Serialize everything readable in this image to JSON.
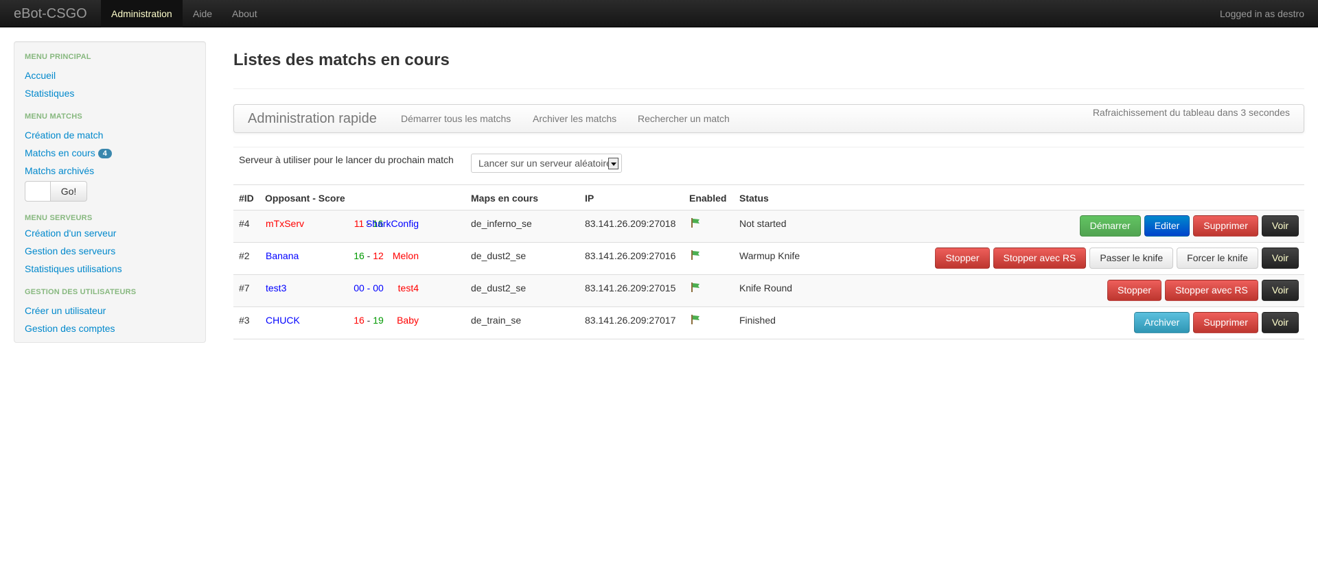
{
  "navbar": {
    "brand": "eBot-CSGO",
    "items": [
      {
        "label": "Administration",
        "active": true
      },
      {
        "label": "Aide",
        "active": false
      },
      {
        "label": "About",
        "active": false
      }
    ],
    "logged_in": "Logged in as destro"
  },
  "sidebar": {
    "headers": [
      "MENU PRINCIPAL",
      "MENU MATCHS",
      "MENU SERVEURS",
      "GESTION DES UTILISATEURS"
    ],
    "main": [
      "Accueil",
      "Statistiques"
    ],
    "matchs": [
      "Création de match",
      "Matchs en cours",
      "Matchs archivés"
    ],
    "matchs_badge": "4",
    "go_label": "Go!",
    "servers": [
      "Création d'un serveur",
      "Gestion des serveurs",
      "Statistiques utilisations"
    ],
    "users": [
      "Créer un utilisateur",
      "Gestion des comptes"
    ]
  },
  "main": {
    "title": "Listes des matchs en cours",
    "quick": {
      "title": "Administration rapide",
      "links": [
        "Démarrer tous les matchs",
        "Archiver les matchs",
        "Rechercher un match"
      ],
      "refresh": "Rafraichissement du tableau dans 3 secondes"
    },
    "server_label": "Serveur à utiliser pour le lancer du prochain match",
    "server_select": "Lancer sur un serveur aléatoire"
  },
  "table": {
    "headers": [
      "#ID",
      "Opposant - Score",
      "Maps en cours",
      "IP",
      "Enabled",
      "Status"
    ],
    "rows": [
      {
        "id": "#4",
        "team1": "mTxServ",
        "score1": "11",
        "sep": " - ",
        "score2": "16",
        "team2": "SharkConfig",
        "map": "de_inferno_se",
        "ip": "83.141.26.209:27018",
        "status": "Not started",
        "actions": [
          "Démarrer",
          "Editer",
          "Supprimer",
          "Voir"
        ]
      },
      {
        "id": "#2",
        "team1": "Banana",
        "score1": "16",
        "sep": " - ",
        "score2": "12",
        "team2": "Melon",
        "map": "de_dust2_se",
        "ip": "83.141.26.209:27016",
        "status": "Warmup Knife",
        "actions": [
          "Stopper",
          "Stopper avec RS",
          "Passer le knife",
          "Forcer le knife",
          "Voir"
        ]
      },
      {
        "id": "#7",
        "team1": "test3",
        "score1": "00",
        "sep": " - ",
        "score2": "00",
        "team2": "test4",
        "map": "de_dust2_se",
        "ip": "83.141.26.209:27015",
        "status": "Knife Round",
        "actions": [
          "Stopper",
          "Stopper avec RS",
          "Voir"
        ]
      },
      {
        "id": "#3",
        "team1": "CHUCK",
        "score1": "16",
        "sep": " - ",
        "score2": "19",
        "team2": "Baby",
        "map": "de_train_se",
        "ip": "83.141.26.209:27017",
        "status": "Finished",
        "actions": [
          "Archiver",
          "Supprimer",
          "Voir"
        ]
      }
    ]
  },
  "colors": {
    "link": "#0088cc",
    "sidebar_header": "#87b87f",
    "team_red": "#ff0000",
    "team_blue": "#0000ff",
    "score_green": "#009900"
  }
}
